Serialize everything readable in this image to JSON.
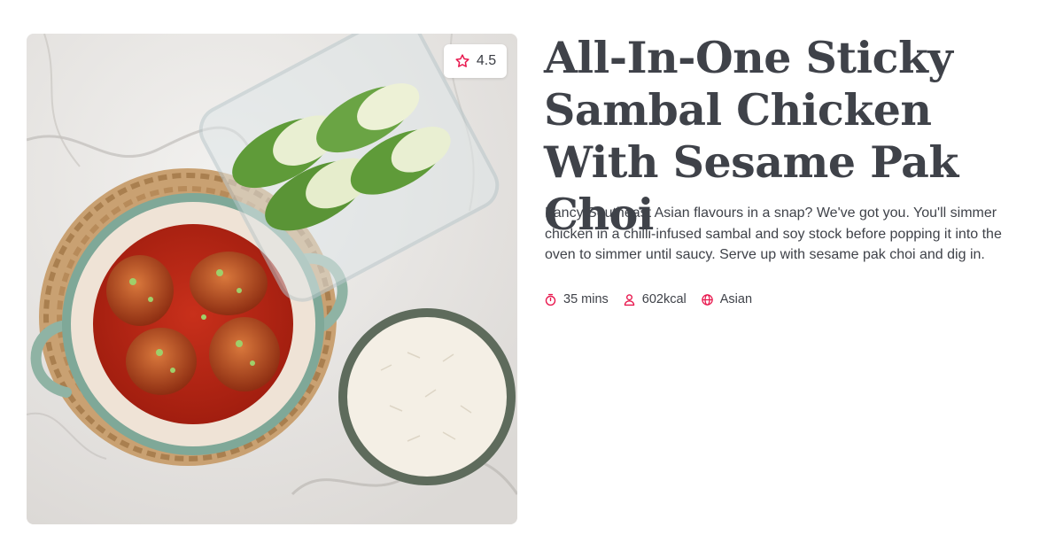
{
  "recipe": {
    "title": "All-In-One Sticky Sambal Chicken With Sesame Pak Choi",
    "description": "Fancy Southeast Asian flavours in a snap? We've got you. You'll simmer chicken in a chilli-infused sambal and soy stock before popping it into the oven to simmer until saucy. Serve up with sesame pak choi and dig in.",
    "rating": "4.5",
    "image_alt": "Sticky sambal chicken in a casserole dish with pak choi and rice"
  },
  "meta": {
    "time": "35 mins",
    "calories": "602kcal",
    "cuisine": "Asian"
  },
  "icons": {
    "rating": "star-icon",
    "time": "stopwatch-icon",
    "calories": "person-icon",
    "cuisine": "globe-icon"
  },
  "colors": {
    "accent": "#e8174d",
    "text": "#3f4249",
    "background": "#ffffff"
  }
}
